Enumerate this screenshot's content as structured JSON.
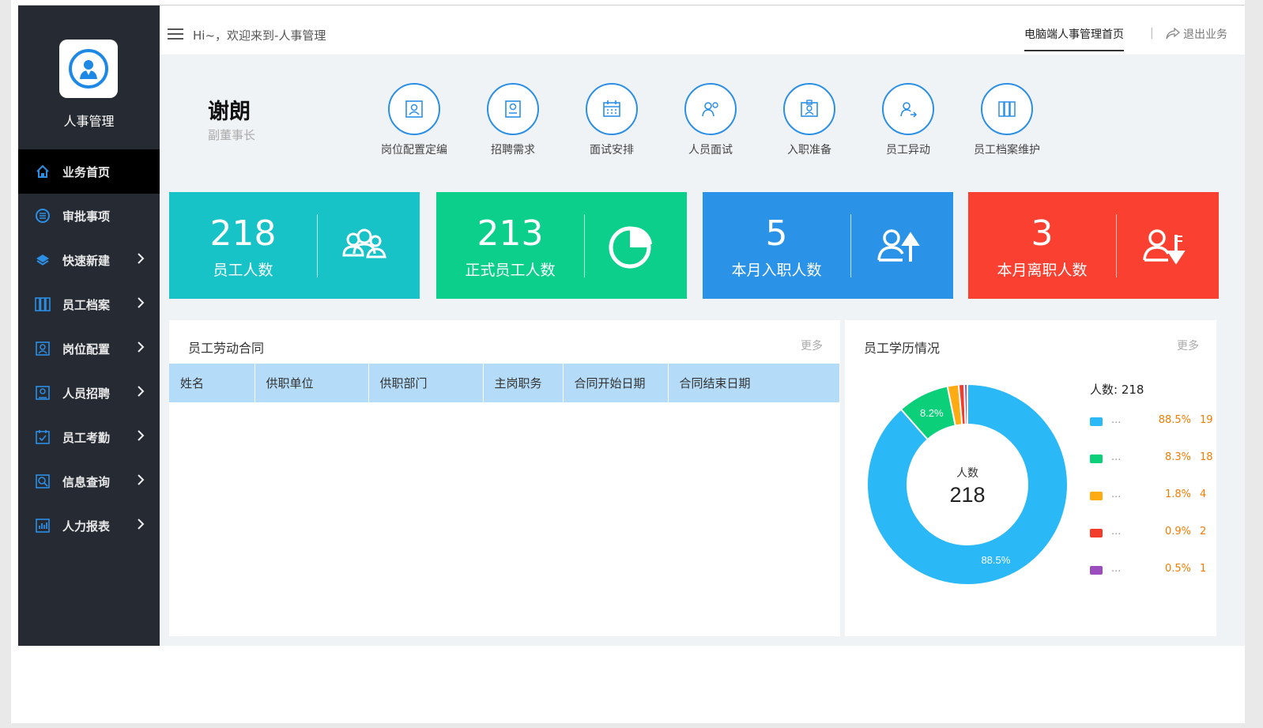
{
  "app": {
    "name": "人事管理"
  },
  "sidebar": {
    "items": [
      {
        "label": "业务首页",
        "icon": "home-icon",
        "active": true,
        "has_children": false
      },
      {
        "label": "审批事项",
        "icon": "list-icon",
        "active": false,
        "has_children": false
      },
      {
        "label": "快速新建",
        "icon": "layers-icon",
        "active": false,
        "has_children": true
      },
      {
        "label": "员工档案",
        "icon": "archive-icon",
        "active": false,
        "has_children": true
      },
      {
        "label": "岗位配置",
        "icon": "position-icon",
        "active": false,
        "has_children": true
      },
      {
        "label": "人员招聘",
        "icon": "recruit-icon",
        "active": false,
        "has_children": true
      },
      {
        "label": "员工考勤",
        "icon": "attendance-icon",
        "active": false,
        "has_children": true
      },
      {
        "label": "信息查询",
        "icon": "query-icon",
        "active": false,
        "has_children": true
      },
      {
        "label": "人力报表",
        "icon": "chart-icon",
        "active": false,
        "has_children": true
      }
    ]
  },
  "header": {
    "greeting": "Hi~，欢迎来到-人事管理",
    "home_link": "电脑端人事管理首页",
    "separator": "|",
    "exit_link": "退出业务"
  },
  "user": {
    "name": "谢朗",
    "role": "副董事长"
  },
  "quick_actions": [
    {
      "label": "岗位配置定编",
      "icon": "position-edit-icon"
    },
    {
      "label": "招聘需求",
      "icon": "recruit-need-icon"
    },
    {
      "label": "面试安排",
      "icon": "calendar-icon"
    },
    {
      "label": "人员面试",
      "icon": "interview-icon"
    },
    {
      "label": "入职准备",
      "icon": "onboard-icon"
    },
    {
      "label": "员工异动",
      "icon": "transfer-icon"
    },
    {
      "label": "员工档案维护",
      "icon": "archive-maintain-icon"
    }
  ],
  "stats": [
    {
      "value": "218",
      "label": "员工人数",
      "color": "#17c3c7",
      "icon": "people-group-icon"
    },
    {
      "value": "213",
      "label": "正式员工人数",
      "color": "#0ccf8b",
      "icon": "pie-icon"
    },
    {
      "value": "5",
      "label": "本月入职人数",
      "color": "#2a93e8",
      "icon": "person-up-icon"
    },
    {
      "value": "3",
      "label": "本月离职人数",
      "color": "#f94031",
      "icon": "person-down-icon"
    }
  ],
  "contracts": {
    "title": "员工劳动合同",
    "more": "更多",
    "columns": [
      "姓名",
      "供职单位",
      "供职部门",
      "主岗职务",
      "合同开始日期",
      "合同结束日期"
    ],
    "rows": []
  },
  "education": {
    "title": "员工学历情况",
    "more": "更多",
    "legend_head": "人数: 218",
    "center_label": "人数",
    "center_value": "218",
    "slice_labels": [
      "88.5%",
      "8.2%"
    ]
  },
  "chart_data": {
    "type": "pie",
    "total": 218,
    "series": [
      {
        "name": "...",
        "percent": "88.5%",
        "value": "19",
        "color": "#2ab8f7"
      },
      {
        "name": "...",
        "percent": "8.3%",
        "value": "18",
        "color": "#0ccf7a"
      },
      {
        "name": "...",
        "percent": "1.8%",
        "value": "4",
        "color": "#ffab14"
      },
      {
        "name": "...",
        "percent": "0.9%",
        "value": "2",
        "color": "#f33b2b"
      },
      {
        "name": "...",
        "percent": "0.5%",
        "value": "1",
        "color": "#9b4dbd"
      }
    ]
  }
}
